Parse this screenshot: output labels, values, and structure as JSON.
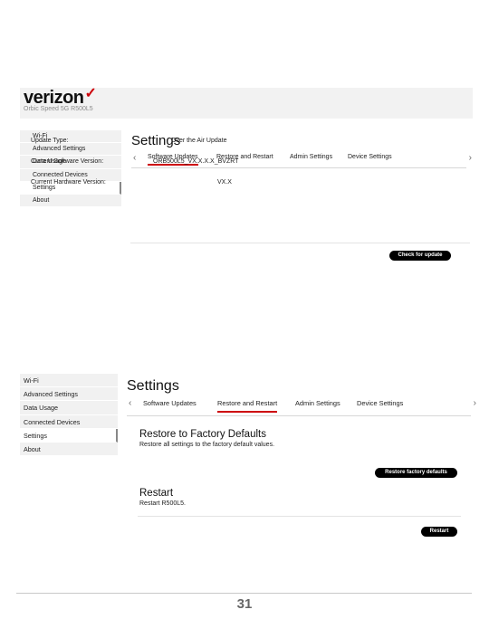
{
  "screen1": {
    "brand": {
      "logo_text": "verizon",
      "logo_check": "✓",
      "device_name": "Orbic Speed 5G R500L5"
    },
    "sidebar": {
      "items": [
        {
          "label": "Wi-Fi"
        },
        {
          "label": "Advanced Settings"
        },
        {
          "label": "Data Usage"
        },
        {
          "label": "Connected Devices"
        },
        {
          "label": "Settings"
        },
        {
          "label": "About"
        }
      ]
    },
    "page_title": "Settings",
    "tabs": [
      "Software Updates",
      "Restore and Restart",
      "Admin Settings",
      "Device Settings"
    ],
    "info": {
      "update_type_label": "Update Type:",
      "update_type_value": "Over the Air Update",
      "software_version_label": "Current Software Version:",
      "software_version_value": "ORB500L5_VX.X.X.X_BVZRT",
      "hardware_version_label": "Current Hardware Version:",
      "hardware_version_value": "VX.X"
    },
    "check_update_button": "Check for update"
  },
  "screen2": {
    "sidebar": {
      "items": [
        {
          "label": "Wi-Fi"
        },
        {
          "label": "Advanced Settings"
        },
        {
          "label": "Data Usage"
        },
        {
          "label": "Connected Devices"
        },
        {
          "label": "Settings"
        },
        {
          "label": "About"
        }
      ]
    },
    "page_title": "Settings",
    "tabs": [
      "Software Updates",
      "Restore and Restart",
      "Admin Settings",
      "Device Settings"
    ],
    "restore": {
      "title": "Restore to Factory Defaults",
      "description": "Restore all settings to the factory default values.",
      "button": "Restore factory defaults"
    },
    "restart": {
      "title": "Restart",
      "description": "Restart R500L5.",
      "button": "Restart"
    }
  },
  "arrows": {
    "left": "‹",
    "right": "›"
  },
  "accent_color": "#cd040b",
  "page_number": "31"
}
